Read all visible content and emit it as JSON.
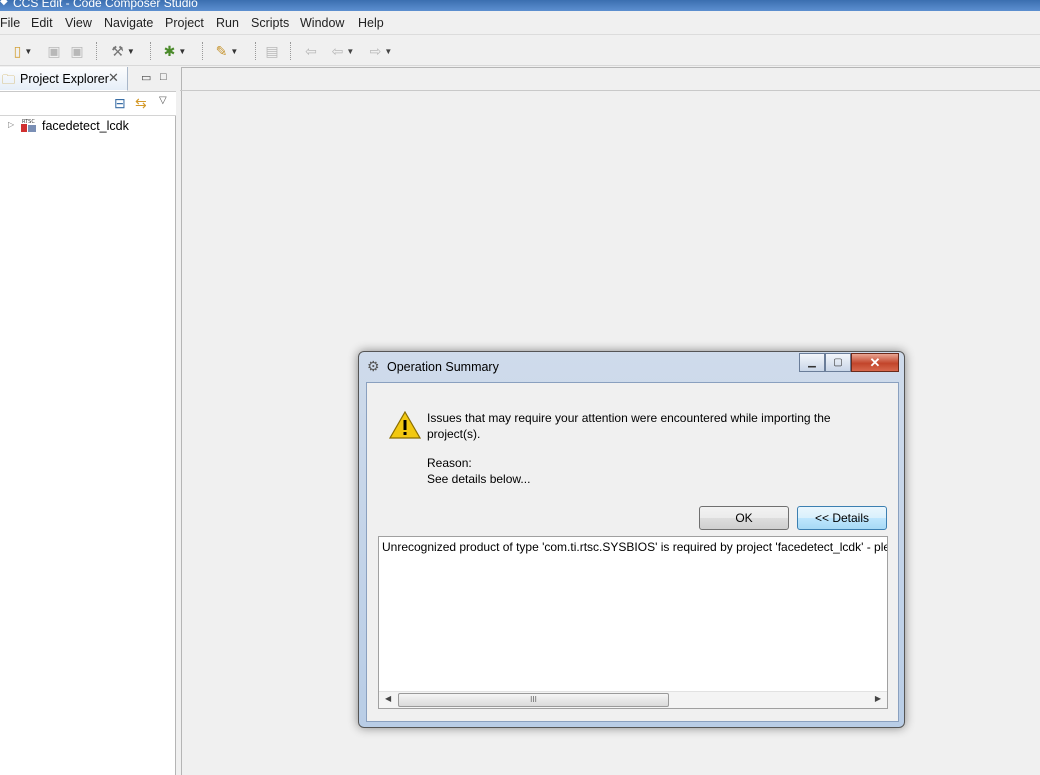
{
  "window": {
    "title": "CCS Edit - Code Composer Studio"
  },
  "menu": [
    "File",
    "Edit",
    "View",
    "Navigate",
    "Project",
    "Run",
    "Scripts",
    "Window",
    "Help"
  ],
  "project_explorer": {
    "tab_label": "Project Explorer",
    "projects": [
      {
        "name": "facedetect_lcdk",
        "badge": "RTSC"
      }
    ]
  },
  "dialog": {
    "title": "Operation Summary",
    "message": "Issues that may require your attention were encountered while importing the project(s).",
    "reason_label": "Reason:",
    "reason_text": "See details below...",
    "ok_label": "OK",
    "details_label": "<< Details",
    "details_text": "Unrecognized product of type 'com.ti.rtsc.SYSBIOS' is required by project 'facedetect_lcdk' - plea",
    "scroll_thumb": "III"
  },
  "icons": {
    "warning": "warning-icon",
    "accent": "#f2c811"
  }
}
